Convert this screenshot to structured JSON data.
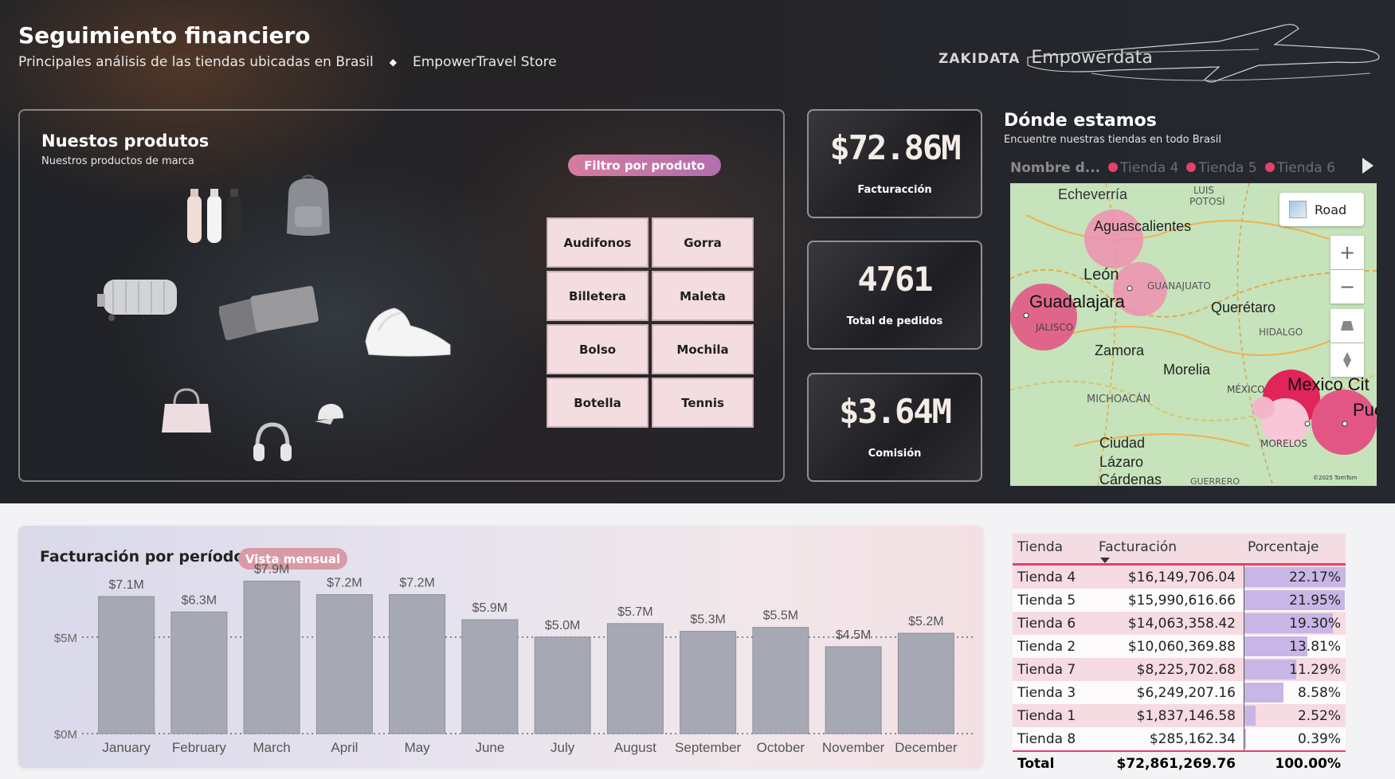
{
  "header": {
    "title": "Seguimiento financiero",
    "subtitle": "Principales análisis de las tiendas ubicadas en Brasil",
    "store": "EmpowerTravel Store",
    "logo_zaki": "ZAKIDATA",
    "logo_emp": "Empowerdata"
  },
  "products": {
    "title": "Nuestos produtos",
    "subtitle": "Nuestros productos de marca",
    "filter_label": "Filtro por produto",
    "buttons": [
      "Audifonos",
      "Gorra",
      "Billetera",
      "Maleta",
      "Bolso",
      "Mochila",
      "Botella",
      "Tennis"
    ]
  },
  "kpis": [
    {
      "value": "$72.86M",
      "label": "Facturacción"
    },
    {
      "value": "4761",
      "label": "Total de pedidos"
    },
    {
      "value": "$3.64M",
      "label": "Comisión"
    }
  ],
  "map": {
    "title": "Dónde estamos",
    "subtitle": "Encuentre nuestras tiendas en todo Brasil",
    "legend_header": "Nombre d...",
    "legend_items": [
      "Tienda 4",
      "Tienda 5",
      "Tienda 6"
    ],
    "road_label": "Road",
    "places": [
      "Echeverría",
      "Aguascalientes",
      "León",
      "Guadalajara",
      "JALISCO",
      "GUANAJUATO",
      "Querétaro",
      "HIDALGO",
      "Zamora",
      "Morelia",
      "MICHOACÁN",
      "MÉXICO",
      "Mexico Cit",
      "Pue",
      "MORELOS",
      "Ciudad",
      "Lázaro",
      "Cárdenas",
      "LUIS",
      "POTOSÍ",
      "GUERRERO"
    ],
    "credit": "©2025 TomTom"
  },
  "chart": {
    "title": "Facturación por período",
    "view_label": "Vista mensual"
  },
  "chart_data": {
    "type": "bar",
    "categories": [
      "January",
      "February",
      "March",
      "April",
      "May",
      "June",
      "July",
      "August",
      "September",
      "October",
      "November",
      "December"
    ],
    "values": [
      7.1,
      6.3,
      7.9,
      7.2,
      7.2,
      5.9,
      5.0,
      5.7,
      5.3,
      5.5,
      4.5,
      5.2
    ],
    "data_labels": [
      "$7.1M",
      "$6.3M",
      "$7.9M",
      "$7.2M",
      "$7.2M",
      "$5.9M",
      "$5.0M",
      "$5.7M",
      "$5.3M",
      "$5.5M",
      "$4.5M",
      "$5.2M"
    ],
    "y_ticks": [
      "$0M",
      "$5M"
    ],
    "ylim": [
      0,
      8.5
    ],
    "color": "#a6a9b3"
  },
  "table": {
    "headers": [
      "Tienda",
      "Facturación",
      "Porcentaje"
    ],
    "rows": [
      {
        "store": "Tienda 4",
        "revenue": "$16,149,706.04",
        "pct": "22.17%",
        "pct_value": 22.17
      },
      {
        "store": "Tienda 5",
        "revenue": "$15,990,616.66",
        "pct": "21.95%",
        "pct_value": 21.95
      },
      {
        "store": "Tienda 6",
        "revenue": "$14,063,358.42",
        "pct": "19.30%",
        "pct_value": 19.3
      },
      {
        "store": "Tienda 2",
        "revenue": "$10,060,369.88",
        "pct": "13.81%",
        "pct_value": 13.81
      },
      {
        "store": "Tienda 7",
        "revenue": "$8,225,702.68",
        "pct": "11.29%",
        "pct_value": 11.29
      },
      {
        "store": "Tienda 3",
        "revenue": "$6,249,207.16",
        "pct": "8.58%",
        "pct_value": 8.58
      },
      {
        "store": "Tienda 1",
        "revenue": "$1,837,146.58",
        "pct": "2.52%",
        "pct_value": 2.52
      },
      {
        "store": "Tienda 8",
        "revenue": "$285,162.34",
        "pct": "0.39%",
        "pct_value": 0.39
      }
    ],
    "total": {
      "store": "Total",
      "revenue": "$72,861,269.76",
      "pct": "100.00%"
    }
  },
  "colors": {
    "accent_pink": "#e4406a",
    "bar_purple": "#c8b6e6",
    "bar_gray": "#a6a9b3"
  }
}
